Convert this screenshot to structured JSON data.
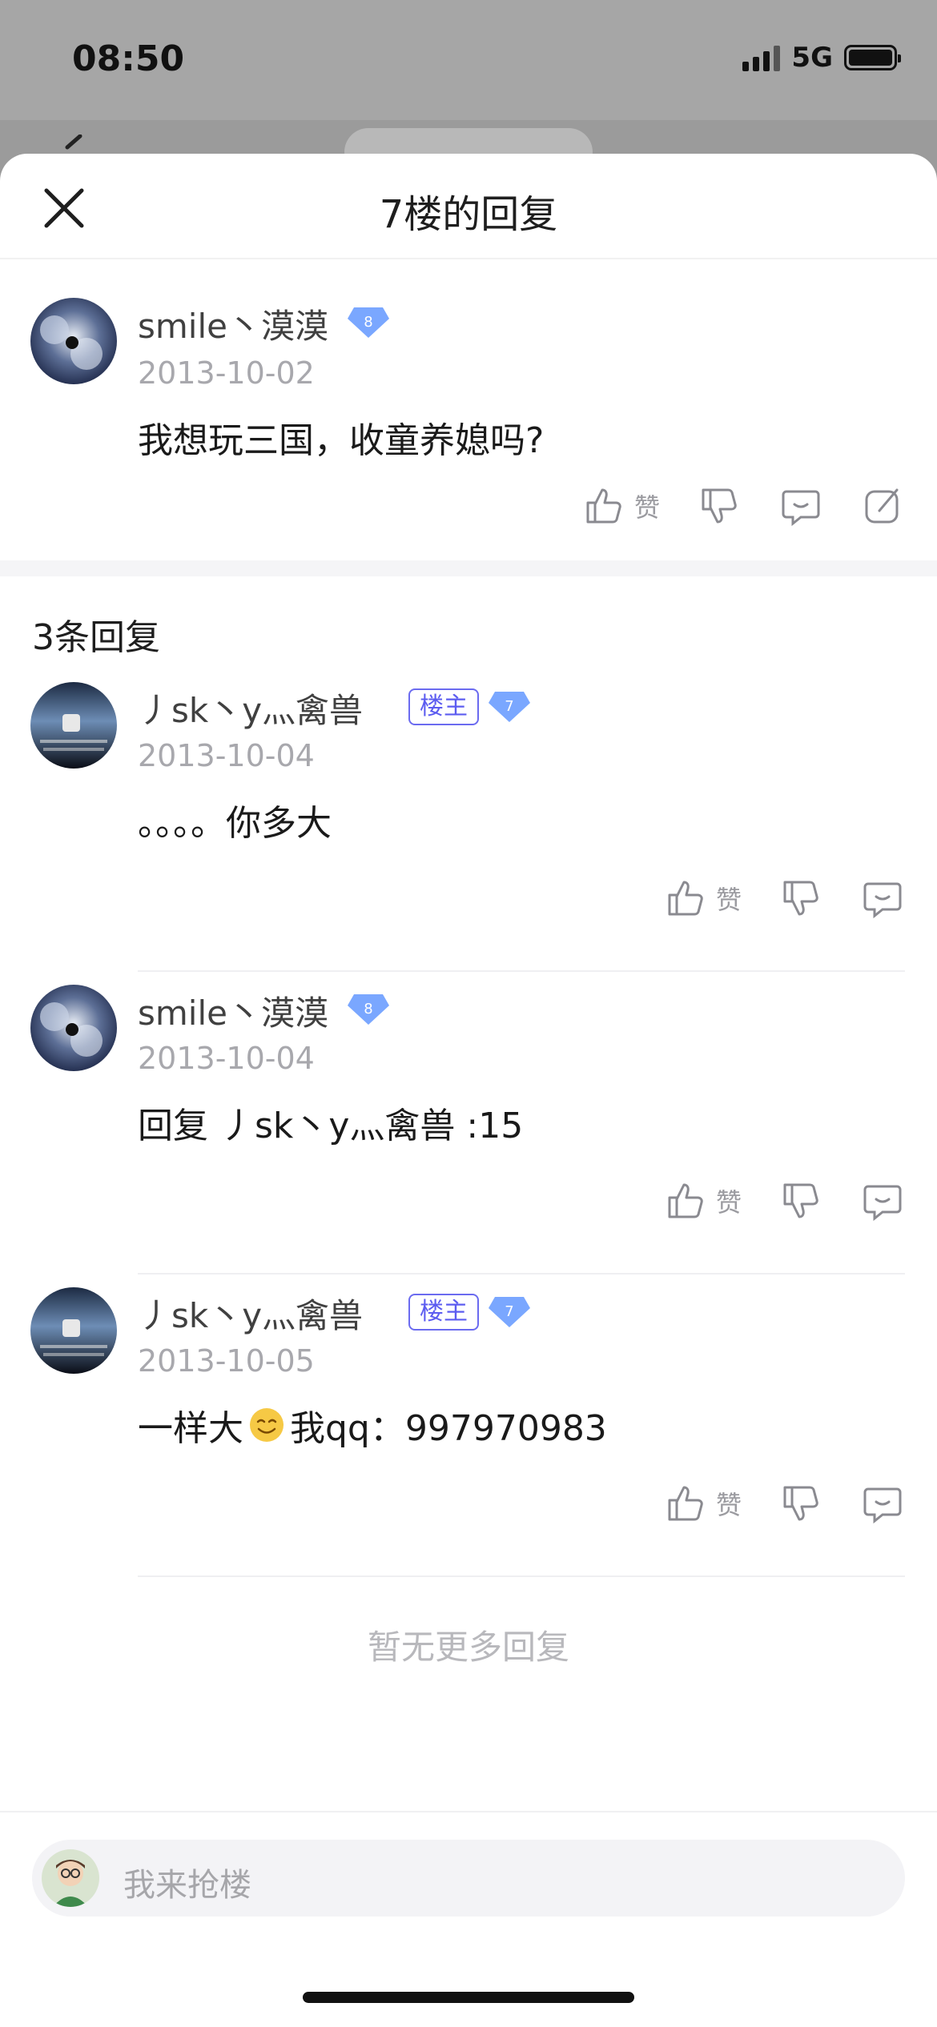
{
  "status_bar": {
    "time": "08:50",
    "network": "5G"
  },
  "sheet": {
    "title": "7楼的回复"
  },
  "main_post": {
    "user": "smile丶漠漠",
    "level": "8",
    "date": "2013-10-02",
    "text": "我想玩三国，收童养媳吗?",
    "like_label": "赞"
  },
  "replies_header": "3条回复",
  "replies": [
    {
      "user": "丿sk丶y灬禽兽",
      "owner_tag": "楼主",
      "level": "7",
      "date": "2013-10-04",
      "text": "。。。。你多大",
      "like_label": "赞"
    },
    {
      "user": "smile丶漠漠",
      "level": "8",
      "date": "2013-10-04",
      "text": "回复 丿sk丶y灬禽兽 :15",
      "like_label": "赞"
    },
    {
      "user": "丿sk丶y灬禽兽",
      "owner_tag": "楼主",
      "level": "7",
      "date": "2013-10-05",
      "text_before": "一样大",
      "text_after": "我qq：997970983",
      "like_label": "赞"
    }
  ],
  "no_more": "暂无更多回复",
  "composer": {
    "placeholder": "我来抢楼"
  },
  "colors": {
    "accent_purple": "#5c5cf0",
    "badge_blue": "#7aa7ff",
    "text_muted": "#a8a8ad"
  }
}
